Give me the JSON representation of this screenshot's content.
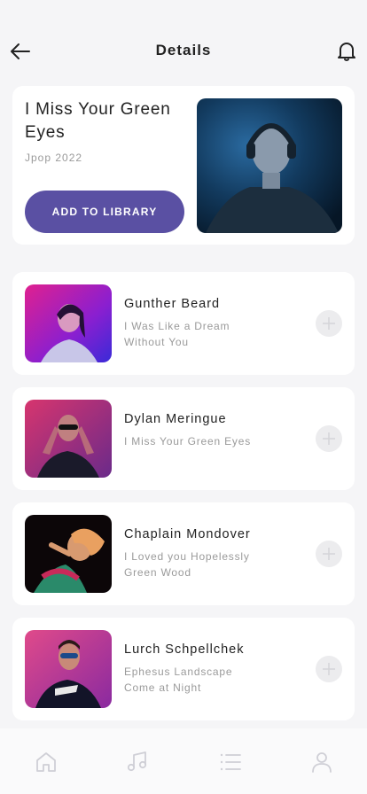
{
  "header": {
    "title": "Details",
    "back_icon": "arrow-left-icon",
    "notification_icon": "bell-icon"
  },
  "album": {
    "title": "I Miss Your Green Eyes",
    "meta": "Jpop 2022",
    "add_button_label": "ADD TO LIBRARY",
    "accent_color": "#5a50a3"
  },
  "tracks": [
    {
      "artist": "Gunther Beard",
      "song": "I Was Like a Dream Without You"
    },
    {
      "artist": "Dylan Meringue",
      "song": "I Miss Your Green Eyes"
    },
    {
      "artist": "Chaplain Mondover",
      "song": "I Loved you Hopelessly Green Wood"
    },
    {
      "artist": "Lurch Schpellchek",
      "song": "Ephesus Landscape Come at Night"
    }
  ],
  "bottom_nav": {
    "items": [
      "home-icon",
      "music-note-icon",
      "list-icon",
      "profile-icon"
    ]
  }
}
